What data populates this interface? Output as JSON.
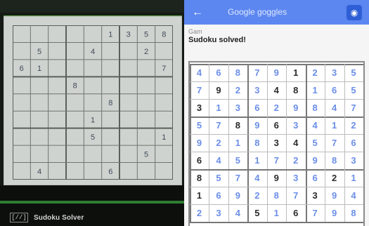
{
  "camera": {
    "app_label": {
      "icon": "sudoku-camera-icon",
      "icon_glyph": "[//]",
      "text": "Sudoku Solver"
    },
    "paper_puzzle": {
      "grid": [
        [
          "",
          "",
          "",
          "",
          "",
          "1",
          "3",
          "5",
          "8"
        ],
        [
          "",
          "5",
          "",
          "",
          "4",
          "",
          "",
          "2",
          ""
        ],
        [
          "6",
          "1",
          "",
          "",
          "",
          "",
          "",
          "",
          "7"
        ],
        [
          "",
          "",
          "",
          "8",
          "",
          "",
          "",
          "",
          ""
        ],
        [
          "",
          "",
          "",
          "",
          "",
          "8",
          "",
          "",
          ""
        ],
        [
          "",
          "",
          "",
          "",
          "1",
          "",
          "",
          "",
          ""
        ],
        [
          "",
          "",
          "",
          "",
          "5",
          "",
          "",
          "",
          "1"
        ],
        [
          "",
          "",
          "",
          "",
          "",
          "",
          "",
          "5",
          ""
        ],
        [
          "",
          "4",
          "",
          "",
          "",
          "6",
          "",
          "",
          ""
        ]
      ]
    }
  },
  "right": {
    "topbar": {
      "title": "Google goggles",
      "back_icon": "back-arrow-icon",
      "back_glyph": "←",
      "action_icon": "camera-icon",
      "action_glyph": "◉"
    },
    "results": {
      "label": "Gam",
      "title": "Sudoku solved!"
    },
    "answer": {
      "solution": [
        [
          "4",
          "6",
          "8",
          "7",
          "9",
          "1",
          "2",
          "3",
          "5"
        ],
        [
          "7",
          "9",
          "2",
          "3",
          "4",
          "8",
          "1",
          "6",
          "5"
        ],
        [
          "3",
          "1",
          "3",
          "6",
          "2",
          "9",
          "8",
          "4",
          "7"
        ],
        [
          "5",
          "7",
          "8",
          "9",
          "6",
          "3",
          "4",
          "1",
          "2"
        ],
        [
          "9",
          "2",
          "1",
          "8",
          "3",
          "4",
          "5",
          "7",
          "6"
        ],
        [
          "6",
          "4",
          "5",
          "1",
          "7",
          "2",
          "9",
          "8",
          "3"
        ],
        [
          "8",
          "5",
          "7",
          "4",
          "9",
          "3",
          "6",
          "2",
          "1"
        ],
        [
          "1",
          "6",
          "9",
          "2",
          "8",
          "7",
          "3",
          "9",
          "4"
        ],
        [
          "2",
          "3",
          "4",
          "5",
          "1",
          "6",
          "7",
          "9",
          "8"
        ]
      ],
      "given_mask": [
        [
          false,
          false,
          false,
          false,
          false,
          true,
          false,
          false,
          false
        ],
        [
          false,
          true,
          false,
          false,
          true,
          true,
          false,
          false,
          false
        ],
        [
          true,
          false,
          false,
          false,
          false,
          false,
          false,
          false,
          false
        ],
        [
          false,
          false,
          true,
          false,
          true,
          false,
          false,
          false,
          false
        ],
        [
          false,
          false,
          false,
          false,
          true,
          true,
          false,
          false,
          false
        ],
        [
          true,
          false,
          false,
          false,
          false,
          false,
          false,
          false,
          false
        ],
        [
          true,
          false,
          false,
          false,
          true,
          false,
          false,
          true,
          false
        ],
        [
          true,
          false,
          false,
          false,
          false,
          false,
          true,
          false,
          false
        ],
        [
          false,
          false,
          false,
          true,
          false,
          true,
          false,
          false,
          false
        ]
      ]
    }
  },
  "colors": {
    "topbar": "#5c87f0",
    "accent": "#2f5fd6",
    "given_digit": "#2b2b2b",
    "solved_digit": "#6b8ee8"
  }
}
